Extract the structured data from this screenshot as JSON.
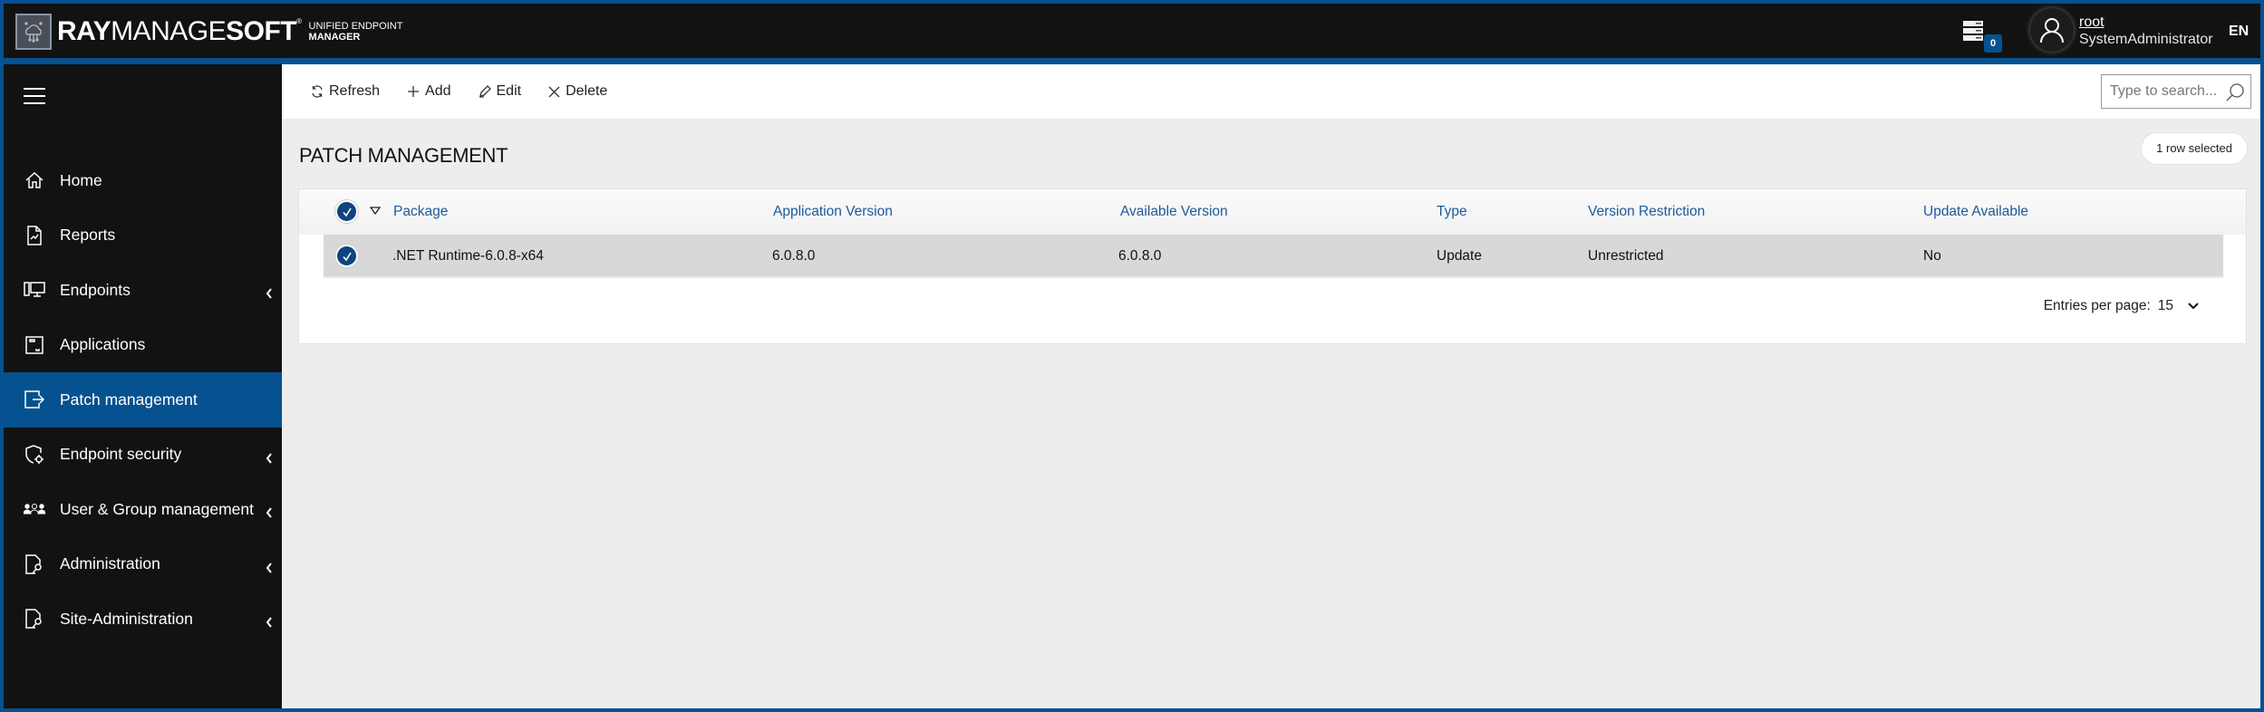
{
  "header": {
    "brand": {
      "part1": "RAY",
      "part2": "MANAGE",
      "part3": "SOFT",
      "registered": "®",
      "sub1": "UNIFIED ENDPOINT",
      "sub2": "MANAGER"
    },
    "notifications_count": "0",
    "user": {
      "name": "root",
      "role": "SystemAdministrator"
    },
    "language": "EN"
  },
  "sidebar": {
    "items": [
      {
        "label": "Home",
        "icon": "home-icon",
        "expandable": false,
        "active": false
      },
      {
        "label": "Reports",
        "icon": "report-icon",
        "expandable": false,
        "active": false
      },
      {
        "label": "Endpoints",
        "icon": "endpoints-icon",
        "expandable": true,
        "active": false
      },
      {
        "label": "Applications",
        "icon": "applications-icon",
        "expandable": false,
        "active": false
      },
      {
        "label": "Patch management",
        "icon": "patch-icon",
        "expandable": false,
        "active": true
      },
      {
        "label": "Endpoint security",
        "icon": "shield-gear-icon",
        "expandable": true,
        "active": false
      },
      {
        "label": "User & Group management",
        "icon": "users-icon",
        "expandable": true,
        "active": false
      },
      {
        "label": "Administration",
        "icon": "admin-key-icon",
        "expandable": true,
        "active": false
      },
      {
        "label": "Site-Administration",
        "icon": "site-admin-key-icon",
        "expandable": true,
        "active": false
      }
    ]
  },
  "toolbar": {
    "refresh_label": "Refresh",
    "add_label": "Add",
    "edit_label": "Edit",
    "delete_label": "Delete",
    "search_placeholder": "Type to search..."
  },
  "page": {
    "title": "PATCH MANAGEMENT",
    "selection_status": "1 row selected"
  },
  "table": {
    "columns": [
      "Package",
      "Application Version",
      "Available Version",
      "Type",
      "Version Restriction",
      "Update Available"
    ],
    "rows": [
      {
        "selected": true,
        "cells": [
          ".NET Runtime-6.0.8-x64",
          "6.0.8.0",
          "6.0.8.0",
          "Update",
          "Unrestricted",
          "No"
        ]
      }
    ],
    "entries_per_page_label": "Entries per page:",
    "entries_per_page_value": "15"
  },
  "colors": {
    "brand_blue": "#06518f",
    "sidebar_bg": "#121212",
    "header_link": "#1c5a9c",
    "selected_row": "#d8d8d8"
  }
}
